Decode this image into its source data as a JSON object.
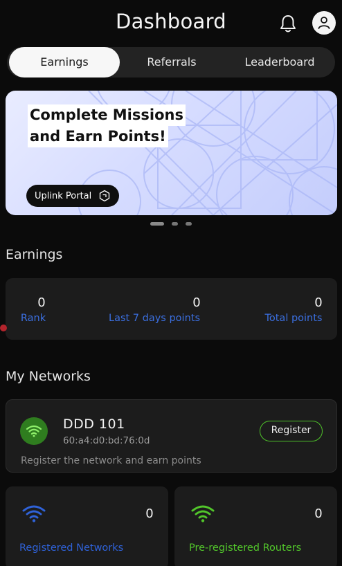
{
  "header": {
    "title": "Dashboard"
  },
  "tabs": [
    {
      "label": "Earnings",
      "active": true
    },
    {
      "label": "Referrals",
      "active": false
    },
    {
      "label": "Leaderboard",
      "active": false
    }
  ],
  "banner": {
    "headline_line1": "Complete Missions",
    "headline_line2": "and Earn Points!",
    "button_label": "Uplink Portal",
    "carousel_pages": 3,
    "carousel_active": 1
  },
  "earnings": {
    "title": "Earnings",
    "stats": [
      {
        "value": "0",
        "label": "Rank"
      },
      {
        "value": "0",
        "label": "Last 7 days points"
      },
      {
        "value": "0",
        "label": "Total points"
      }
    ]
  },
  "networks": {
    "title": "My Networks",
    "item": {
      "name": "DDD 101",
      "mac": "60:a4:d0:bd:76:0d",
      "register_label": "Register",
      "hint": "Register the network and earn points"
    },
    "summary": [
      {
        "value": "0",
        "label": "Registered Networks",
        "color": "#2f62d8"
      },
      {
        "value": "0",
        "label": "Pre-registered Routers",
        "color": "#52c62b"
      }
    ]
  },
  "colors": {
    "accent_blue": "#3b6fe0",
    "accent_green": "#4fc32a",
    "background": "#0b0b0b",
    "card": "#1c1c1c"
  },
  "icons": [
    "bell-icon",
    "user-icon",
    "portal-arrow-icon",
    "wifi-icon"
  ]
}
